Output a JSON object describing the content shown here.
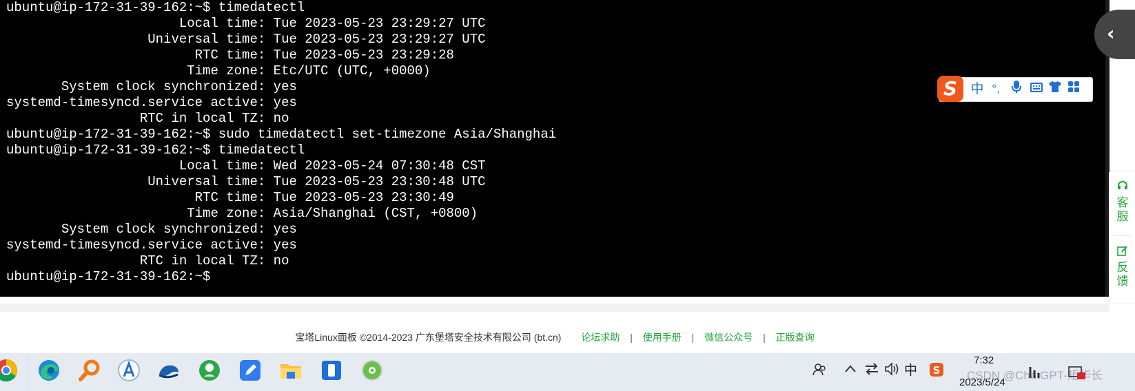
{
  "terminal": {
    "lines": [
      "ubuntu@ip-172-31-39-162:~$ timedatectl",
      "                      Local time: Tue 2023-05-23 23:29:27 UTC",
      "                  Universal time: Tue 2023-05-23 23:29:27 UTC",
      "                        RTC time: Tue 2023-05-23 23:29:28",
      "                       Time zone: Etc/UTC (UTC, +0000)",
      "       System clock synchronized: yes",
      "systemd-timesyncd.service active: yes",
      "                 RTC in local TZ: no",
      "ubuntu@ip-172-31-39-162:~$ sudo timedatectl set-timezone Asia/Shanghai",
      "ubuntu@ip-172-31-39-162:~$ timedatectl",
      "                      Local time: Wed 2023-05-24 07:30:48 CST",
      "                  Universal time: Tue 2023-05-23 23:30:48 UTC",
      "                        RTC time: Tue 2023-05-23 23:30:49",
      "                       Time zone: Asia/Shanghai (CST, +0800)",
      "       System clock synchronized: yes",
      "systemd-timesyncd.service active: yes",
      "                 RTC in local TZ: no",
      "ubuntu@ip-172-31-39-162:~$ "
    ]
  },
  "collapse_tab": {
    "icon": "chevron-left-icon",
    "glyph": "‹"
  },
  "ime_toolbar": {
    "logo": "S",
    "mode": "中",
    "punct": "°,",
    "items": [
      "mic-icon",
      "keyboard-icon",
      "skin-shirt-icon",
      "apps-grid-icon"
    ]
  },
  "service_panel": {
    "support_label": "客服",
    "feedback_label": "反馈"
  },
  "footer": {
    "copyright": "宝塔Linux面板 ©2014-2023 广东堡塔安全技术有限公司 (bt.cn)",
    "links": [
      "论坛求助",
      "使用手册",
      "微信公众号",
      "正版查询"
    ],
    "separator": "|"
  },
  "taskbar": {
    "apps": [
      "chrome-icon",
      "edge-icon",
      "search-magnifier-icon",
      "app-a-icon",
      "whale-icon",
      "maps-pin-icon",
      "pen-app-icon",
      "file-explorer-icon",
      "phone-link-icon",
      "green-app-icon"
    ],
    "tray": {
      "ime": "中",
      "clock_time": "7:32",
      "clock_date": "2023/5/24",
      "watermark": "CSDN @ChatGPT-矩华长"
    }
  },
  "colors": {
    "accent": "#20a53a",
    "terminal_bg": "#000000",
    "ime_orange": "#f0581c",
    "ime_blue": "#1f6fd8"
  }
}
